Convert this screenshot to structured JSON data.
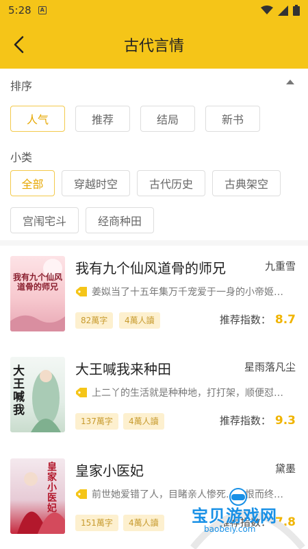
{
  "status_bar": {
    "time": "5:28",
    "notif_icon": "A"
  },
  "header": {
    "title": "古代言情"
  },
  "sort": {
    "label": "排序",
    "options": [
      "人气",
      "推荐",
      "结局",
      "新书"
    ]
  },
  "subcategory": {
    "label": "小类",
    "options": [
      "全部",
      "穿越时空",
      "古代历史",
      "古典架空",
      "宫闱宅斗",
      "经商种田"
    ]
  },
  "books": [
    {
      "title": "我有九个仙风道骨的师兄",
      "author": "九重雪",
      "desc": "姜姒当了十五年集万千宠爱于一身的小帝姬…",
      "words": "82萬字",
      "readers": "4萬人讀",
      "rec_label": "推荐指数：",
      "score": "8.7",
      "cover_text": "我有九个仙风道骨的师兄"
    },
    {
      "title": "大王喊我来种田",
      "author": "星雨落凡尘",
      "desc": "上二丫的生活就是种种地，打打架，顺便怼…",
      "words": "137萬字",
      "readers": "4萬人讀",
      "rec_label": "推荐指数：",
      "score": "9.3",
      "cover_text": "大王喊我"
    },
    {
      "title": "皇家小医妃",
      "author": "黛墨",
      "desc": "前世她爱错了人，目睹亲人惨死…含恨而终…",
      "words": "151萬字",
      "readers": "4萬人讀",
      "rec_label": "推荐指数：",
      "score": "7.8",
      "cover_text": "皇家小医妃"
    }
  ],
  "watermark": {
    "text": "宝贝游戏网",
    "url": "baobeiy.com"
  },
  "colors": {
    "brand": "#f5c518",
    "accent": "#f0b400",
    "pill_bg": "#fdf0cf"
  }
}
